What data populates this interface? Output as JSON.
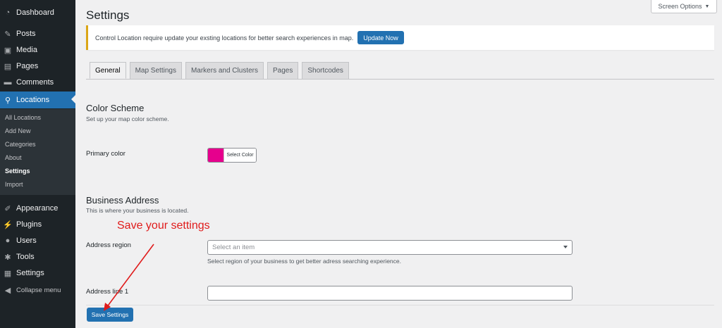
{
  "sidebar": {
    "items": [
      {
        "label": "Dashboard",
        "icon": "dashboard-icon"
      },
      {
        "label": "Posts",
        "icon": "pin-icon"
      },
      {
        "label": "Media",
        "icon": "media-icon"
      },
      {
        "label": "Pages",
        "icon": "page-icon"
      },
      {
        "label": "Comments",
        "icon": "comment-icon"
      },
      {
        "label": "Locations",
        "icon": "location-pin-icon"
      }
    ],
    "submenu": [
      "All Locations",
      "Add New",
      "Categories",
      "About",
      "Settings",
      "Import"
    ],
    "items_bottom": [
      {
        "label": "Appearance",
        "icon": "brush-icon"
      },
      {
        "label": "Plugins",
        "icon": "plug-icon"
      },
      {
        "label": "Users",
        "icon": "user-icon"
      },
      {
        "label": "Tools",
        "icon": "wrench-icon"
      },
      {
        "label": "Settings",
        "icon": "settings-icon"
      },
      {
        "label": "Collapse menu",
        "icon": "collapse-icon"
      }
    ]
  },
  "header": {
    "title": "Settings",
    "screen_options": "Screen Options"
  },
  "notice": {
    "text": "Control Location require update your exsting locations for better search experiences in map.",
    "button": "Update Now"
  },
  "tabs": [
    "General",
    "Map Settings",
    "Markers and Clusters",
    "Pages",
    "Shortcodes"
  ],
  "color_scheme": {
    "title": "Color Scheme",
    "description": "Set up your map color scheme.",
    "primary_label": "Primary color",
    "primary_value": "#e6008d",
    "select_label": "Select Color"
  },
  "business_address": {
    "title": "Business Address",
    "description": "This is where your business is located.",
    "region_label": "Address region",
    "region_placeholder": "Select an item",
    "region_help": "Select region of your business to get better adress searching experience.",
    "line1_label": "Address line 1",
    "line1_value": ""
  },
  "save_button": "Save Settings",
  "annotation": "Save your settings",
  "colors": {
    "accent": "#2271b1",
    "sidebar": "#1d2327",
    "annotation": "#e01b1b",
    "notice_border": "#dba617"
  }
}
